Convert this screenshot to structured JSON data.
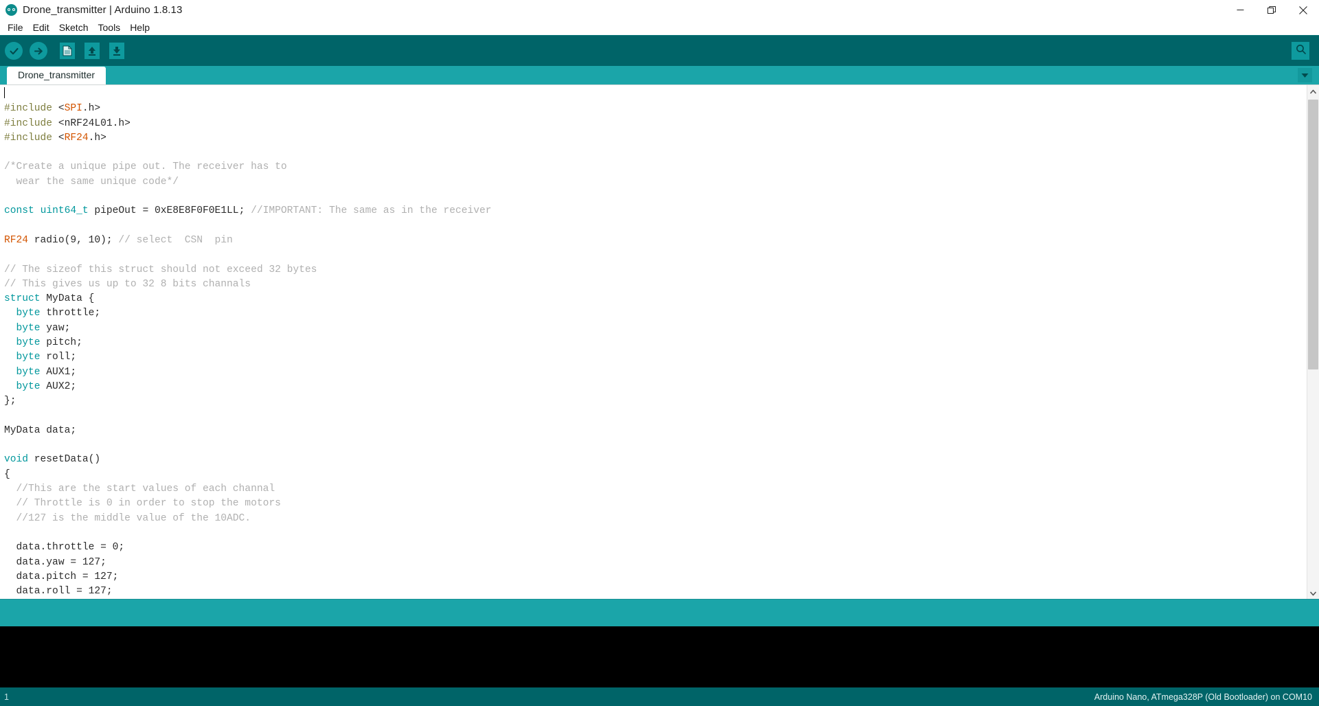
{
  "window": {
    "title": "Drone_transmitter | Arduino 1.8.13",
    "logo_icon": "arduino-logo-icon",
    "minimize_icon": "minimize-icon",
    "maximize_icon": "restore-icon",
    "close_icon": "close-icon"
  },
  "menubar": {
    "items": [
      {
        "label": "File"
      },
      {
        "label": "Edit"
      },
      {
        "label": "Sketch"
      },
      {
        "label": "Tools"
      },
      {
        "label": "Help"
      }
    ]
  },
  "toolbar": {
    "buttons": [
      {
        "name": "verify-button",
        "icon": "checkmark-icon",
        "tooltip": "Verify"
      },
      {
        "name": "upload-button",
        "icon": "arrow-right-icon",
        "tooltip": "Upload"
      },
      {
        "name": "new-button",
        "icon": "new-document-icon",
        "tooltip": "New"
      },
      {
        "name": "open-button",
        "icon": "arrow-up-icon",
        "tooltip": "Open"
      },
      {
        "name": "save-button",
        "icon": "arrow-down-icon",
        "tooltip": "Save"
      }
    ],
    "serial_monitor": {
      "name": "serial-monitor-button",
      "icon": "magnifier-icon",
      "tooltip": "Serial Monitor"
    }
  },
  "tabs": {
    "items": [
      {
        "label": "Drone_transmitter",
        "active": true
      }
    ],
    "menu_icon": "chevron-down-icon"
  },
  "editor": {
    "scrollbar": {
      "up_icon": "chevron-up-icon",
      "down_icon": "chevron-down-icon",
      "thumb_percent": 55
    },
    "lines": [
      {
        "segments": [
          {
            "t": "",
            "c": "plain"
          }
        ],
        "caret": true
      },
      {
        "segments": [
          {
            "t": "#include ",
            "c": "pre"
          },
          {
            "t": "<",
            "c": "plain"
          },
          {
            "t": "SPI",
            "c": "lib"
          },
          {
            "t": ".h>",
            "c": "plain"
          }
        ]
      },
      {
        "segments": [
          {
            "t": "#include ",
            "c": "pre"
          },
          {
            "t": "<nRF24L01.h>",
            "c": "plain"
          }
        ]
      },
      {
        "segments": [
          {
            "t": "#include ",
            "c": "pre"
          },
          {
            "t": "<",
            "c": "plain"
          },
          {
            "t": "RF24",
            "c": "lib"
          },
          {
            "t": ".h>",
            "c": "plain"
          }
        ]
      },
      {
        "segments": [
          {
            "t": "",
            "c": "plain"
          }
        ]
      },
      {
        "segments": [
          {
            "t": "/*Create a unique pipe out. The receiver has to",
            "c": "com"
          }
        ]
      },
      {
        "segments": [
          {
            "t": "  wear the same unique code*/",
            "c": "com"
          }
        ]
      },
      {
        "segments": [
          {
            "t": "",
            "c": "plain"
          }
        ]
      },
      {
        "segments": [
          {
            "t": "const",
            "c": "kw"
          },
          {
            "t": " ",
            "c": "plain"
          },
          {
            "t": "uint64_t",
            "c": "kw"
          },
          {
            "t": " pipeOut = 0xE8E8F0F0E1LL; ",
            "c": "plain"
          },
          {
            "t": "//IMPORTANT: The same as in the receiver",
            "c": "com"
          }
        ]
      },
      {
        "segments": [
          {
            "t": "",
            "c": "plain"
          }
        ]
      },
      {
        "segments": [
          {
            "t": "RF24",
            "c": "lib"
          },
          {
            "t": " radio(9, 10); ",
            "c": "plain"
          },
          {
            "t": "// select  CSN  pin",
            "c": "com"
          }
        ]
      },
      {
        "segments": [
          {
            "t": "",
            "c": "plain"
          }
        ]
      },
      {
        "segments": [
          {
            "t": "// The sizeof this struct should not exceed 32 bytes",
            "c": "com"
          }
        ]
      },
      {
        "segments": [
          {
            "t": "// This gives us up to 32 8 bits channals",
            "c": "com"
          }
        ]
      },
      {
        "segments": [
          {
            "t": "struct",
            "c": "kw"
          },
          {
            "t": " MyData {",
            "c": "plain"
          }
        ]
      },
      {
        "segments": [
          {
            "t": "  ",
            "c": "plain"
          },
          {
            "t": "byte",
            "c": "kw"
          },
          {
            "t": " throttle;",
            "c": "plain"
          }
        ]
      },
      {
        "segments": [
          {
            "t": "  ",
            "c": "plain"
          },
          {
            "t": "byte",
            "c": "kw"
          },
          {
            "t": " yaw;",
            "c": "plain"
          }
        ]
      },
      {
        "segments": [
          {
            "t": "  ",
            "c": "plain"
          },
          {
            "t": "byte",
            "c": "kw"
          },
          {
            "t": " pitch;",
            "c": "plain"
          }
        ]
      },
      {
        "segments": [
          {
            "t": "  ",
            "c": "plain"
          },
          {
            "t": "byte",
            "c": "kw"
          },
          {
            "t": " roll;",
            "c": "plain"
          }
        ]
      },
      {
        "segments": [
          {
            "t": "  ",
            "c": "plain"
          },
          {
            "t": "byte",
            "c": "kw"
          },
          {
            "t": " AUX1;",
            "c": "plain"
          }
        ]
      },
      {
        "segments": [
          {
            "t": "  ",
            "c": "plain"
          },
          {
            "t": "byte",
            "c": "kw"
          },
          {
            "t": " AUX2;",
            "c": "plain"
          }
        ]
      },
      {
        "segments": [
          {
            "t": "};",
            "c": "plain"
          }
        ]
      },
      {
        "segments": [
          {
            "t": "",
            "c": "plain"
          }
        ]
      },
      {
        "segments": [
          {
            "t": "MyData data;",
            "c": "plain"
          }
        ]
      },
      {
        "segments": [
          {
            "t": "",
            "c": "plain"
          }
        ]
      },
      {
        "segments": [
          {
            "t": "void",
            "c": "kw"
          },
          {
            "t": " resetData()",
            "c": "plain"
          }
        ]
      },
      {
        "segments": [
          {
            "t": "{",
            "c": "plain"
          }
        ]
      },
      {
        "segments": [
          {
            "t": "  //This are the start values of each channal",
            "c": "com"
          }
        ]
      },
      {
        "segments": [
          {
            "t": "  // Throttle is 0 in order to stop the motors",
            "c": "com"
          }
        ]
      },
      {
        "segments": [
          {
            "t": "  //127 is the middle value of the 10ADC.",
            "c": "com"
          }
        ]
      },
      {
        "segments": [
          {
            "t": "",
            "c": "plain"
          }
        ]
      },
      {
        "segments": [
          {
            "t": "  data.throttle = 0;",
            "c": "plain"
          }
        ]
      },
      {
        "segments": [
          {
            "t": "  data.yaw = 127;",
            "c": "plain"
          }
        ]
      },
      {
        "segments": [
          {
            "t": "  data.pitch = 127;",
            "c": "plain"
          }
        ]
      },
      {
        "segments": [
          {
            "t": "  data.roll = 127;",
            "c": "plain"
          }
        ]
      }
    ]
  },
  "console": {
    "text": ""
  },
  "statusbar": {
    "line_number": "1",
    "board_info": "Arduino Nano, ATmega328P (Old Bootloader) on COM10"
  },
  "colors": {
    "toolbar_bg": "#006468",
    "tabbar_bg": "#1ba5a9",
    "accent": "#0e9a9e",
    "keyword": "#00979c",
    "library": "#d35400",
    "preprocessor": "#7e7e3f",
    "comment": "#b0b0b0",
    "console_bg": "#000000"
  }
}
